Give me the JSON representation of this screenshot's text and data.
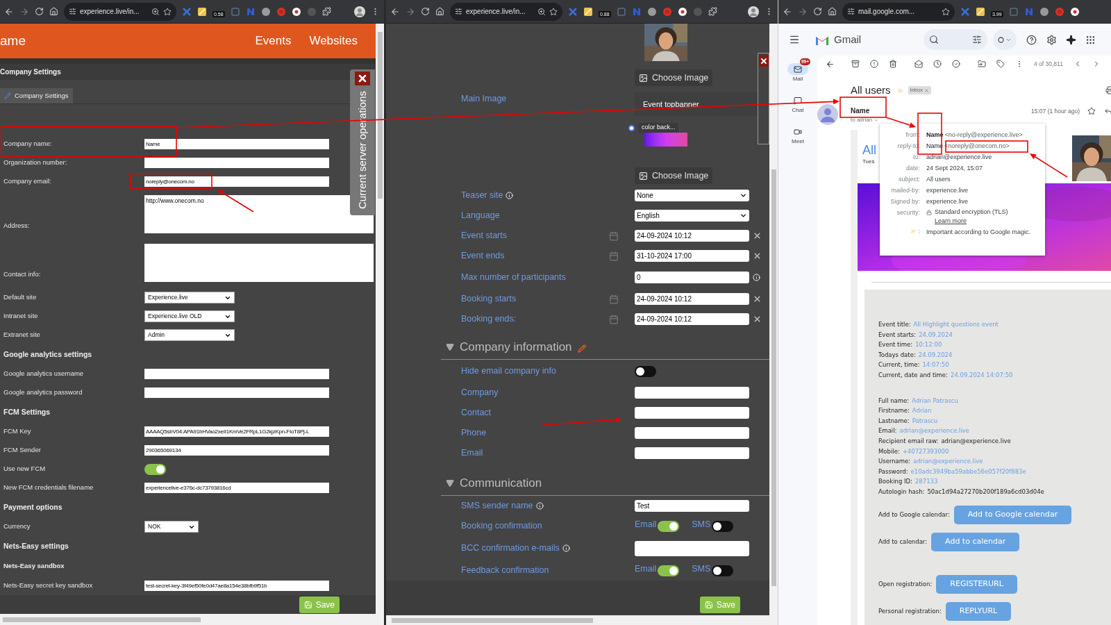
{
  "browser_windows": [
    {
      "url": "experience.live/in...",
      "zoomed": true,
      "extension_badge": "0.58"
    },
    {
      "url": "experience.live/in...",
      "zoomed": true,
      "extension_badge": "0.88"
    },
    {
      "url": "mail.google.com...",
      "zoomed": false,
      "extension_badge": "3.99"
    }
  ],
  "admin": {
    "brand": "ame",
    "nav": [
      "Events",
      "Websites"
    ],
    "page_title": "Company Settings",
    "tabs": [
      {
        "label": "Company Settings",
        "selected": true
      }
    ],
    "side_panel_title": "Current server operations",
    "rows": [
      {
        "kind": "input",
        "label": "Company name:",
        "value": "Name"
      },
      {
        "kind": "input",
        "label": "Organization number:"
      },
      {
        "kind": "input",
        "label": "Company email:",
        "value": "noreply@onecom.no"
      },
      {
        "kind": "textarea",
        "label": "Address:",
        "value": "http://www.onecom.no"
      },
      {
        "kind": "textarea",
        "label": "Contact info:"
      },
      {
        "kind": "select",
        "label": "Default site",
        "value": "Experience.live"
      },
      {
        "kind": "select",
        "label": "Intranet site",
        "value": "Experience.live OLD"
      },
      {
        "kind": "select",
        "label": "Extranet site",
        "value": "Admin"
      },
      {
        "kind": "heading",
        "label": "Google analytics settings"
      },
      {
        "kind": "input",
        "label": "Google analytics username"
      },
      {
        "kind": "input",
        "label": "Google analytics password"
      },
      {
        "kind": "heading",
        "label": "FCM Settings"
      },
      {
        "kind": "input",
        "label": "FCM Key",
        "value": "AAAAQ5sbV04:APA91bHVao2xeII1KmVe2FRpL1G2kjzKpn-FIoT8Pj-L"
      },
      {
        "kind": "input",
        "label": "FCM Sender",
        "value": "290365069134"
      },
      {
        "kind": "toggle",
        "label": "Use new FCM",
        "on": true
      },
      {
        "kind": "input",
        "label": "New FCM credentials filename",
        "value": "experiencelive-e376c-dc73793816cd"
      },
      {
        "kind": "heading",
        "label": "Payment options"
      },
      {
        "kind": "select_small",
        "label": "Currency",
        "value": "NOK"
      },
      {
        "kind": "heading",
        "label": "Nets-Easy settings"
      },
      {
        "kind": "subheading",
        "label": "Nets-Easy sandbox"
      },
      {
        "kind": "input",
        "label": "Nets-Easy secret key sandbox",
        "value": "test-secret-key-3f49ef50fe0d47ae8a154e38bfb9f51b"
      }
    ],
    "save": "Save"
  },
  "event_form": {
    "main_image": {
      "label": "Main Image",
      "choose_image": "Choose Image",
      "banner_title": "Event topbanner",
      "color_option": {
        "label": "color back...",
        "selected": true
      },
      "choose_image_2": "Choose Image"
    },
    "fields": [
      {
        "kind": "select",
        "label": "Teaser site",
        "info": true,
        "value": "None"
      },
      {
        "kind": "select",
        "label": "Language",
        "info": false,
        "value": "English"
      },
      {
        "kind": "date",
        "label": "Event starts",
        "value": "24-09-2024 10:12"
      },
      {
        "kind": "date",
        "label": "Event ends",
        "value": "31-10-2024 17:00"
      },
      {
        "kind": "number",
        "label": "Max number of participants",
        "info": true,
        "value": "0"
      },
      {
        "kind": "date",
        "label": "Booking starts",
        "value": "24-09-2024 10:12"
      },
      {
        "kind": "date",
        "label": "Booking ends:",
        "value": "24-09-2024 10:12"
      }
    ],
    "sections": [
      {
        "title": "Company information",
        "expanded": true,
        "editable": true,
        "fields": [
          {
            "kind": "toggle",
            "label": "Hide email company info",
            "on": false
          },
          {
            "kind": "input",
            "label": "Company"
          },
          {
            "kind": "input",
            "label": "Contact"
          },
          {
            "kind": "input",
            "label": "Phone"
          },
          {
            "kind": "input",
            "label": "Email"
          }
        ]
      },
      {
        "title": "Communication",
        "expanded": true,
        "editable": false,
        "fields": [
          {
            "kind": "input",
            "label": "SMS sender name",
            "info": true,
            "value": "Test"
          },
          {
            "kind": "channels",
            "label": "Booking confirmation",
            "channels": [
              {
                "label": "Email",
                "on": true
              },
              {
                "label": "SMS",
                "on": false
              }
            ]
          },
          {
            "kind": "textarea",
            "label": "BCC confirmation e-mails",
            "info": true
          },
          {
            "kind": "channels",
            "label": "Feedback confirmation",
            "channels": [
              {
                "label": "Email",
                "on": true
              },
              {
                "label": "SMS",
                "on": false
              }
            ]
          }
        ]
      }
    ],
    "save": "Save"
  },
  "gmail": {
    "app_name": "Gmail",
    "rail": [
      {
        "label": "Mail",
        "selected": true,
        "badge": "99+"
      },
      {
        "label": "Chat",
        "selected": false
      },
      {
        "label": "Meet",
        "selected": false
      }
    ],
    "counter": "4 of 30,811",
    "subject": "All users",
    "label_chip": "Inbox",
    "sender": "Name",
    "recipient": "to adrian",
    "time": "15:07 (1 hour ago)",
    "details": [
      {
        "kind": "sender",
        "key": "from:",
        "name": "Name",
        "bold": true,
        "address": "<no-reply@experience.live>"
      },
      {
        "kind": "sender",
        "key": "reply-to:",
        "name": "Name",
        "bold": false,
        "address": "<noreply@onecom.no>"
      },
      {
        "kind": "text",
        "key": "to:",
        "value": "adrian@experience.live"
      },
      {
        "kind": "text",
        "key": "date:",
        "value": "24 Sept 2024, 15:07"
      },
      {
        "kind": "text",
        "key": "subject:",
        "value": "All users"
      },
      {
        "kind": "text",
        "key": "mailed-by:",
        "value": "experience.live"
      },
      {
        "kind": "text",
        "key": "Signed by:",
        "value": "experience.live"
      },
      {
        "kind": "security",
        "key": "security:",
        "value": "Standard encryption (TLS)",
        "link": "Learn more"
      },
      {
        "kind": "important",
        "key": ":",
        "value": "Important according to Google magic."
      }
    ],
    "body": {
      "heading": "All",
      "date_partial": "Tues",
      "line_groups": [
        [
          {
            "label": "Event title:",
            "value": "All Highlight questions event",
            "linked": true
          },
          {
            "label": "Event starts:",
            "value": "24.09.2024",
            "linked": true
          },
          {
            "label": "Event time:",
            "value": "10:12:00",
            "linked": true
          },
          {
            "label": "Todays date:",
            "value": "24.09.2024",
            "linked": true
          },
          {
            "label": "Current, time:",
            "value": "14:07:50",
            "linked": true
          },
          {
            "label": "Current, date and time:",
            "value": "24.09.2024 14:07:50",
            "linked": true
          }
        ],
        [
          {
            "label": "Full name:",
            "value": "Adrian Patrascu",
            "linked": true
          },
          {
            "label": "Firstname:",
            "value": "Adrian",
            "linked": true
          },
          {
            "label": "Lastname:",
            "value": "Patrascu",
            "linked": true
          },
          {
            "label": "Email:",
            "value": "adrian@experience.live",
            "linked": true
          },
          {
            "label": "Recipient email raw:",
            "value": "adrian@experience.live",
            "linked": false
          },
          {
            "label": "Mobile:",
            "value": "+40727393000",
            "linked": true
          },
          {
            "label": "Username:",
            "value": "adrian@experience.live",
            "linked": true
          },
          {
            "label": "Password:",
            "value": "e10adc3949ba59abbe56e057f20f883e",
            "linked": true
          },
          {
            "label": "Booking ID:",
            "value": "287133",
            "linked": true
          },
          {
            "label": "Autologin hash:",
            "value": "50ac1d94a27270b200f189a6cd03d04e",
            "linked": false
          }
        ]
      ],
      "actions": [
        {
          "label": "Add to Google calendar:",
          "button": "Add to Google calendar"
        },
        {
          "label": "Add to calendar:",
          "button": "Add to calendar"
        },
        {
          "label": "Open registration:",
          "button": "REGISTERURL"
        },
        {
          "label": "Personal registration:",
          "button": "REPLYURL"
        }
      ]
    }
  }
}
